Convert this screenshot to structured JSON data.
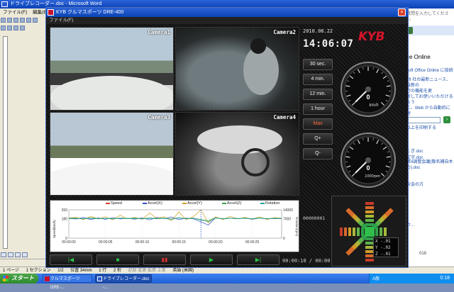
{
  "word": {
    "title": "ドライブレコーダー.doc - Microsoft Word",
    "menu": [
      "ファイル(F)",
      "編集(E)"
    ],
    "controls": {
      "min": "_",
      "max": "□",
      "close": "×"
    },
    "taskpane": {
      "help_placeholder": "質問を入力してください",
      "title": "ce Online",
      "link1": "soft Office Online に接続",
      "para": "oft 社の最新ニュース、最新の\n行の機能を更\n新してお使いいただけるよう\nに、Web から自動的に更",
      "link2": "以上を印刷する",
      "doc1": "こぎ.doc",
      "doc2": "文字.doc",
      "doc3": "第4調整会議(敬名補自木\nの).doc",
      "doc4": "次会の方",
      "doc5": "ウ...",
      "ann": "018"
    },
    "status": {
      "page": "1 ページ",
      "section": "1 セクション",
      "pages": "1/2",
      "position": "位置 34mm",
      "line": "1 行",
      "col": "2 桁",
      "modes": "記録 変更 拡張 上書",
      "lang": "英語 (米国)"
    }
  },
  "kyb": {
    "title": "KYB クルマスポーツ DRE-400",
    "menu": "ファイル(F)",
    "close": "×",
    "date": "2010.08.22",
    "time": "14:06:07",
    "logo": "KYB",
    "cameras": [
      "Camera1",
      "Camera2",
      "Camera3",
      "Camera4"
    ],
    "buttons": [
      "30 sec.",
      "4 min.",
      "12 min.",
      "1 hour",
      "Max",
      "Q+",
      "Q-"
    ],
    "active_button": "Max",
    "frame_number": "00000001",
    "time_readout": "00:00:18 / 00:00:29",
    "gauges": [
      {
        "unit": "km/h",
        "value": 0
      },
      {
        "unit": "1000rpm",
        "value": 0
      }
    ],
    "gmeter": {
      "x": "X -.01",
      "y": "Y -.02",
      "z": "Z -.01"
    },
    "playback": [
      {
        "name": "skip-start",
        "glyph": "|◀",
        "color": "#2ec24a"
      },
      {
        "name": "stop",
        "glyph": "■",
        "color": "#2ec24a"
      },
      {
        "name": "pause",
        "glyph": "▮▮",
        "color": "#d03030"
      },
      {
        "name": "play",
        "glyph": "▶",
        "color": "#2ec24a"
      },
      {
        "name": "skip-end",
        "glyph": "▶|",
        "color": "#2ec24a"
      }
    ]
  },
  "chart_data": {
    "type": "line",
    "legend": [
      "Speed",
      "Accel(X)",
      "Accel(Y)",
      "Accel(Z)",
      "Rotation"
    ],
    "colors": {
      "Speed": "#d04030",
      "Accel(X)": "#3050c0",
      "Accel(Y)": "#d0a020",
      "Accel(Z)": "#40a040",
      "Rotation": "#20a0a0"
    },
    "ylabel_left": "Speed(km/h)",
    "ylabel_right": "Rotation(rpm)",
    "yticks_left": [
      "260",
      "180",
      "0"
    ],
    "yticks_right": [
      "14000",
      "7000",
      "0"
    ],
    "xticks": [
      "00:00:00",
      "00:00:05",
      "00:00:10",
      "00:00:15",
      "00:00:20",
      "00:00:25"
    ],
    "cursor_x": 18,
    "x": [
      0,
      1,
      2,
      3,
      4,
      5,
      6,
      7,
      8,
      9,
      10,
      11,
      12,
      13,
      14,
      15,
      16,
      17,
      18,
      19,
      20,
      21,
      22,
      23,
      24,
      25,
      26,
      27,
      28,
      29
    ],
    "series": [
      {
        "name": "Accel(X)",
        "values": [
          180,
          175,
          190,
          170,
          185,
          172,
          188,
          176,
          182,
          174,
          186,
          168,
          190,
          178,
          194,
          170,
          184,
          176,
          150,
          120,
          188,
          176,
          182,
          178,
          186,
          172,
          184,
          176,
          180,
          178
        ]
      },
      {
        "name": "Accel(Y)",
        "values": [
          185,
          190,
          170,
          200,
          178,
          196,
          168,
          210,
          176,
          190,
          172,
          230,
          182,
          196,
          160,
          240,
          170,
          198,
          260,
          140,
          196,
          170,
          200,
          176,
          190,
          174,
          196,
          170,
          188,
          182
        ]
      },
      {
        "name": "Accel(Z)",
        "values": [
          182,
          184,
          178,
          186,
          180,
          183,
          179,
          185,
          181,
          184,
          178,
          186,
          180,
          183,
          176,
          188,
          180,
          184,
          170,
          160,
          186,
          180,
          184,
          181,
          183,
          179,
          185,
          180,
          183,
          181
        ]
      },
      {
        "name": "Rotation",
        "values": [
          178,
          180,
          176,
          182,
          177,
          181,
          175,
          183,
          178,
          180,
          176,
          182,
          177,
          181,
          172,
          186,
          176,
          182,
          166,
          150,
          184,
          176,
          182,
          178,
          181,
          176,
          183,
          177,
          180,
          179
        ]
      }
    ],
    "ylim": [
      0,
      260
    ]
  },
  "taskbar": {
    "start": "スタート",
    "tasks": [
      "クルマスポーツ DRE-...",
      "ドライブレコーダー.doc -..."
    ],
    "ime": "A般",
    "clock": "0:18"
  }
}
